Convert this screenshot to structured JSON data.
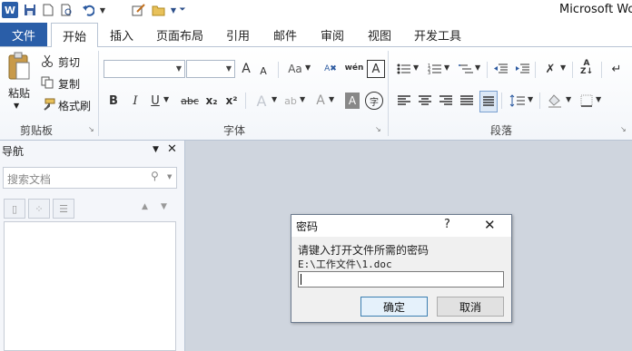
{
  "app": {
    "title": "Microsoft Wo"
  },
  "quick_access": {
    "icons": [
      "word-logo-icon",
      "save-icon",
      "new-document-icon",
      "print-preview-icon",
      "undo-icon",
      "undo-dropdown-icon",
      "edit-icon",
      "open-folder-icon",
      "customize-quick-access-icon"
    ]
  },
  "tabs": {
    "file": "文件",
    "items": [
      "开始",
      "插入",
      "页面布局",
      "引用",
      "邮件",
      "审阅",
      "视图",
      "开发工具"
    ]
  },
  "ribbon": {
    "clipboard": {
      "label": "剪贴板",
      "paste": "粘贴",
      "cut": "剪切",
      "copy": "复制",
      "format_painter": "格式刷"
    },
    "font": {
      "label": "字体",
      "font_name": "",
      "font_size": "",
      "glyphs": {
        "grow": "A",
        "shrink": "A",
        "case": "Aa",
        "bold": "B",
        "italic": "I",
        "underline": "U",
        "strike": "abc",
        "sub": "x₂",
        "sup": "x²",
        "text_effect": "A",
        "highlight": "ab",
        "font_color": "A",
        "char_shade": "A",
        "enclose": "字",
        "phonetic": "wén",
        "border": "A"
      }
    },
    "paragraph": {
      "label": "段落"
    }
  },
  "nav_pane": {
    "title": "导航",
    "search_placeholder": "搜索文档"
  },
  "dialog": {
    "title": "密码",
    "help": "?",
    "close": "✕",
    "prompt": "请键入打开文件所需的密码",
    "path": "E:\\工作文件\\1.doc",
    "password_value": "",
    "ok": "确定",
    "cancel": "取消"
  },
  "colors": {
    "file_tab": "#2a5ea8",
    "workspace": "#cfd5de"
  }
}
